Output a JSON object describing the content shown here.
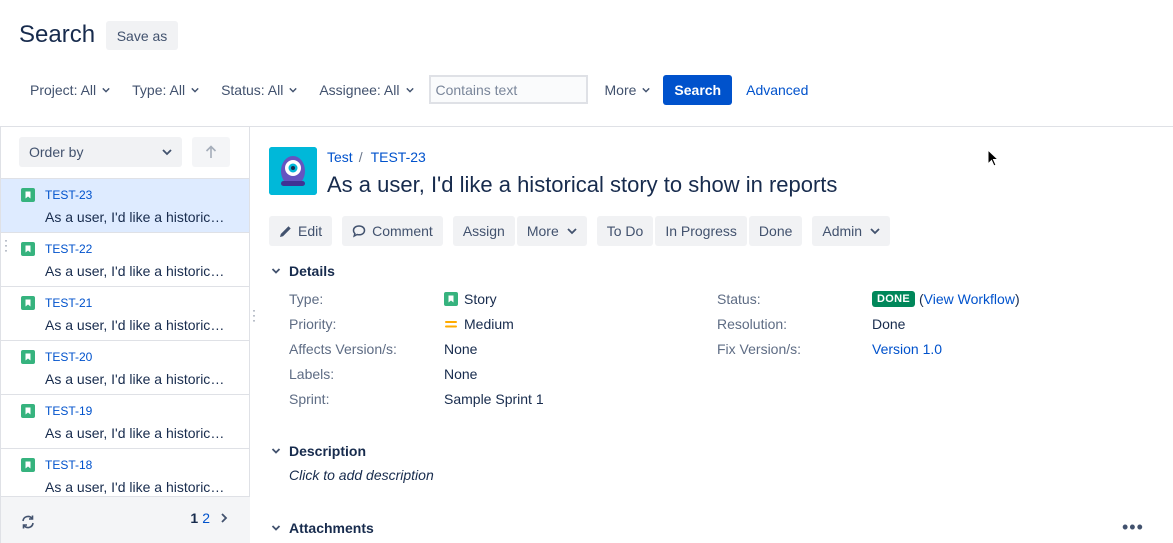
{
  "header": {
    "title": "Search",
    "save_as_label": "Save as"
  },
  "filters": {
    "project": "Project: All",
    "type": "Type: All",
    "status": "Status: All",
    "assignee": "Assignee: All",
    "text_placeholder": "Contains text",
    "more": "More",
    "search_button": "Search",
    "advanced_link": "Advanced"
  },
  "list": {
    "order_by": "Order by",
    "items": [
      {
        "key": "TEST-23",
        "summary": "As a user, I'd like a historical story to show in reports"
      },
      {
        "key": "TEST-22",
        "summary": "As a user, I'd like a historical story to show in reports"
      },
      {
        "key": "TEST-21",
        "summary": "As a user, I'd like a historical story to show in reports"
      },
      {
        "key": "TEST-20",
        "summary": "As a user, I'd like a historical story to show in reports"
      },
      {
        "key": "TEST-19",
        "summary": "As a user, I'd like a historical story to show in reports"
      },
      {
        "key": "TEST-18",
        "summary": "As a user, I'd like a historical story to show in reports"
      }
    ],
    "pager": {
      "current": "1",
      "next": "2"
    }
  },
  "issue": {
    "project": "Test",
    "key": "TEST-23",
    "title": "As a user, I'd like a historical story to show in reports",
    "actions": {
      "edit": "Edit",
      "comment": "Comment",
      "assign": "Assign",
      "more": "More",
      "todo": "To Do",
      "in_progress": "In Progress",
      "done": "Done",
      "admin": "Admin"
    },
    "details": {
      "heading": "Details",
      "type_label": "Type:",
      "type_value": "Story",
      "priority_label": "Priority:",
      "priority_value": "Medium",
      "affects_label": "Affects Version/s:",
      "affects_value": "None",
      "labels_label": "Labels:",
      "labels_value": "None",
      "sprint_label": "Sprint:",
      "sprint_value": "Sample Sprint 1",
      "status_label": "Status:",
      "status_value": "DONE",
      "view_workflow_open": "(",
      "view_workflow": "View Workflow",
      "view_workflow_close": ")",
      "resolution_label": "Resolution:",
      "resolution_value": "Done",
      "fix_label": "Fix Version/s:",
      "fix_value": "Version 1.0"
    },
    "description": {
      "heading": "Description",
      "placeholder": "Click to add description"
    },
    "attachments": {
      "heading": "Attachments",
      "more": "•••"
    }
  },
  "colors": {
    "primary": "#0052cc",
    "story_green": "#36b37e",
    "done_green": "#00875a",
    "priority_medium": "#ffab00",
    "selected_row": "#deebff"
  }
}
